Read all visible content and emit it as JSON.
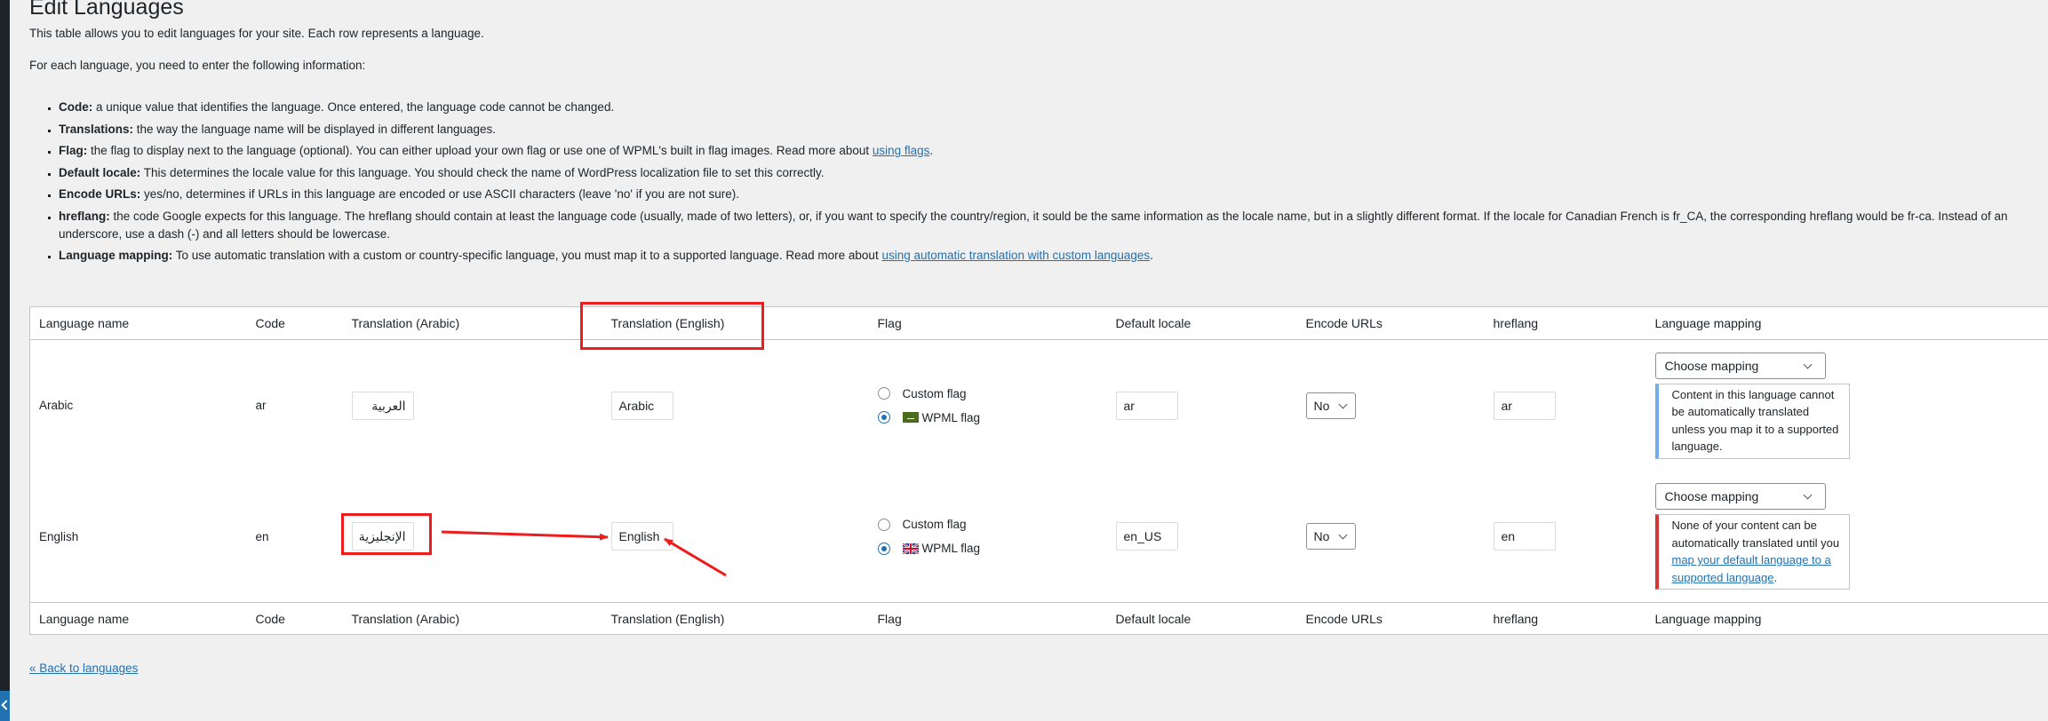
{
  "page": {
    "title": "Edit Languages",
    "intro": "This table allows you to edit languages for your site. Each row represents a language.",
    "intro2": "For each language, you need to enter the following information:",
    "definitions": [
      {
        "term": "Code:",
        "text": " a unique value that identifies the language. Once entered, the language code cannot be changed."
      },
      {
        "term": "Translations:",
        "text": " the way the language name will be displayed in different languages."
      },
      {
        "term": "Flag:",
        "text": " the flag to display next to the language (optional). You can either upload your own flag or use one of WPML's built in flag images. Read more about ",
        "link": "using flags",
        "after": "."
      },
      {
        "term": "Default locale:",
        "text": " This determines the locale value for this language. You should check the name of WordPress localization file to set this correctly."
      },
      {
        "term": "Encode URLs:",
        "text": " yes/no, determines if URLs in this language are encoded or use ASCII characters (leave 'no' if you are not sure)."
      },
      {
        "term": "hreflang:",
        "text": " the code Google expects for this language. The hreflang should contain at least the language code (usually, made of two letters), or, if you want to specify the country/region, it sould be the same information as the locale name, but in a slightly different format. If the locale for Canadian French is fr_CA, the corresponding hreflang would be fr-ca. Instead of an underscore, use a dash (-) and all letters should be lowercase."
      },
      {
        "term": "Language mapping:",
        "text": " To use automatic translation with a custom or country-specific language, you must map it to a supported language. Read more about ",
        "link": "using automatic translation with custom languages",
        "after": "."
      }
    ],
    "back_link": "« Back to languages"
  },
  "table": {
    "headers": [
      "Language name",
      "Code",
      "Translation (Arabic)",
      "Translation (English)",
      "Flag",
      "Default locale",
      "Encode URLs",
      "hreflang",
      "Language mapping"
    ],
    "flag_options": {
      "custom": "Custom flag",
      "wpml": "WPML flag"
    },
    "rows": [
      {
        "name": "Arabic",
        "code": "ar",
        "tr_arabic": "العربية",
        "tr_english": "Arabic",
        "flag_selected": "WPML flag",
        "flag_icon": "saudi-arabia-flag-icon",
        "locale": "ar",
        "encode_urls": "No",
        "hreflang": "ar",
        "mapping": "Choose mapping",
        "notice": {
          "type": "info",
          "text": "Content in this language cannot be automatically translated unless you map it to a supported language."
        }
      },
      {
        "name": "English",
        "code": "en",
        "tr_arabic": "الإنجليزية",
        "tr_english": "English",
        "flag_selected": "WPML flag",
        "flag_icon": "uk-flag-icon",
        "locale": "en_US",
        "encode_urls": "No",
        "hreflang": "en",
        "mapping": "Choose mapping",
        "notice": {
          "type": "error",
          "text_before": "None of your content can be automatically translated until you ",
          "link": "map your default language to a supported language",
          "text_after": "."
        }
      }
    ]
  },
  "colors": {
    "annotation_red": "#ee1c1c",
    "link_blue": "#2271b1",
    "info_border": "#72aee6",
    "error_border": "#d63638"
  }
}
